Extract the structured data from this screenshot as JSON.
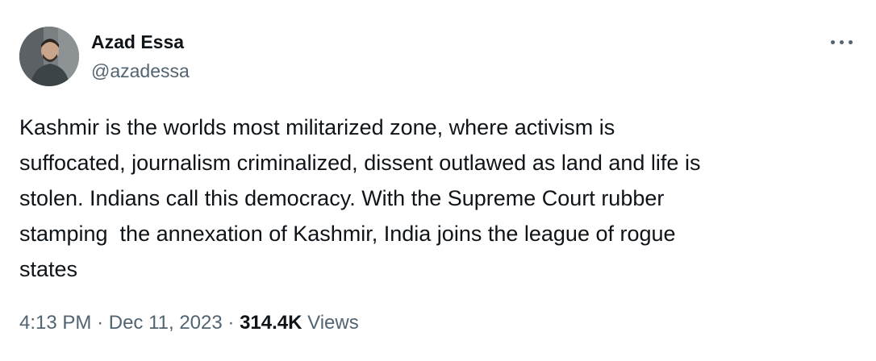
{
  "author": {
    "name": "Azad Essa",
    "handle": "@azadessa",
    "avatar": "profile-photo"
  },
  "more_icon": "ellipsis-icon",
  "tweet": {
    "lines": [
      "Kashmir is the worlds most militarized zone, where activism is",
      "suffocated, journalism criminalized, dissent outlawed as land and life is",
      "stolen. Indians call this democracy. With the Supreme Court rubber",
      "stamping  the annexation of Kashmir, India joins the league of rogue",
      "states"
    ]
  },
  "meta": {
    "time": "4:13 PM",
    "separator": "·",
    "date": "Dec 11, 2023",
    "views_count": "314.4K",
    "views_label": "Views"
  },
  "colors": {
    "text": "#0f1419",
    "secondary": "#536471",
    "background": "#ffffff"
  }
}
